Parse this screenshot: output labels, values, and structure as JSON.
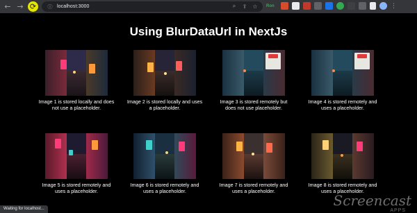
{
  "browser": {
    "url": "localhost:3000",
    "status_text": "Waiting for localhost...",
    "extension_label": "Ron"
  },
  "page": {
    "title": "Using BlurDataUrl in NextJs",
    "cards": [
      {
        "caption": "Image 1 is stored locally and does not use a placeholder."
      },
      {
        "caption": "Image 2 is stored locally and uses a placeholder."
      },
      {
        "caption": "Image 3 is stored remotely but does not use placeholder."
      },
      {
        "caption": "Image 4 is stored remotely and uses a placeholder."
      },
      {
        "caption": "Image 5 is stored remotely and uses a placeholder."
      },
      {
        "caption": "Image 6 is stored remotely and uses a placeholder."
      },
      {
        "caption": "Image 7 is stored remotely and uses a placeholder."
      },
      {
        "caption": "Image 8 is stored remotely and uses a placeholder."
      }
    ]
  },
  "watermark": {
    "brand": "Screencast",
    "sub": "APPS"
  },
  "colors": {
    "toolbar": "#35363a",
    "omnibox": "#202124",
    "page_bg": "#000000",
    "neon_pink": "#ff3b7a",
    "neon_orange": "#ff9a3c",
    "neon_teal": "#3fd0c9"
  },
  "icons": [
    "back-arrow-icon",
    "forward-arrow-icon",
    "reload-icon",
    "home-icon",
    "info-icon",
    "search-icon",
    "share-icon",
    "bookmark-star-icon",
    "puzzle-extensions-icon",
    "sidebar-icon",
    "profile-avatar-icon",
    "menu-kebab-icon"
  ]
}
